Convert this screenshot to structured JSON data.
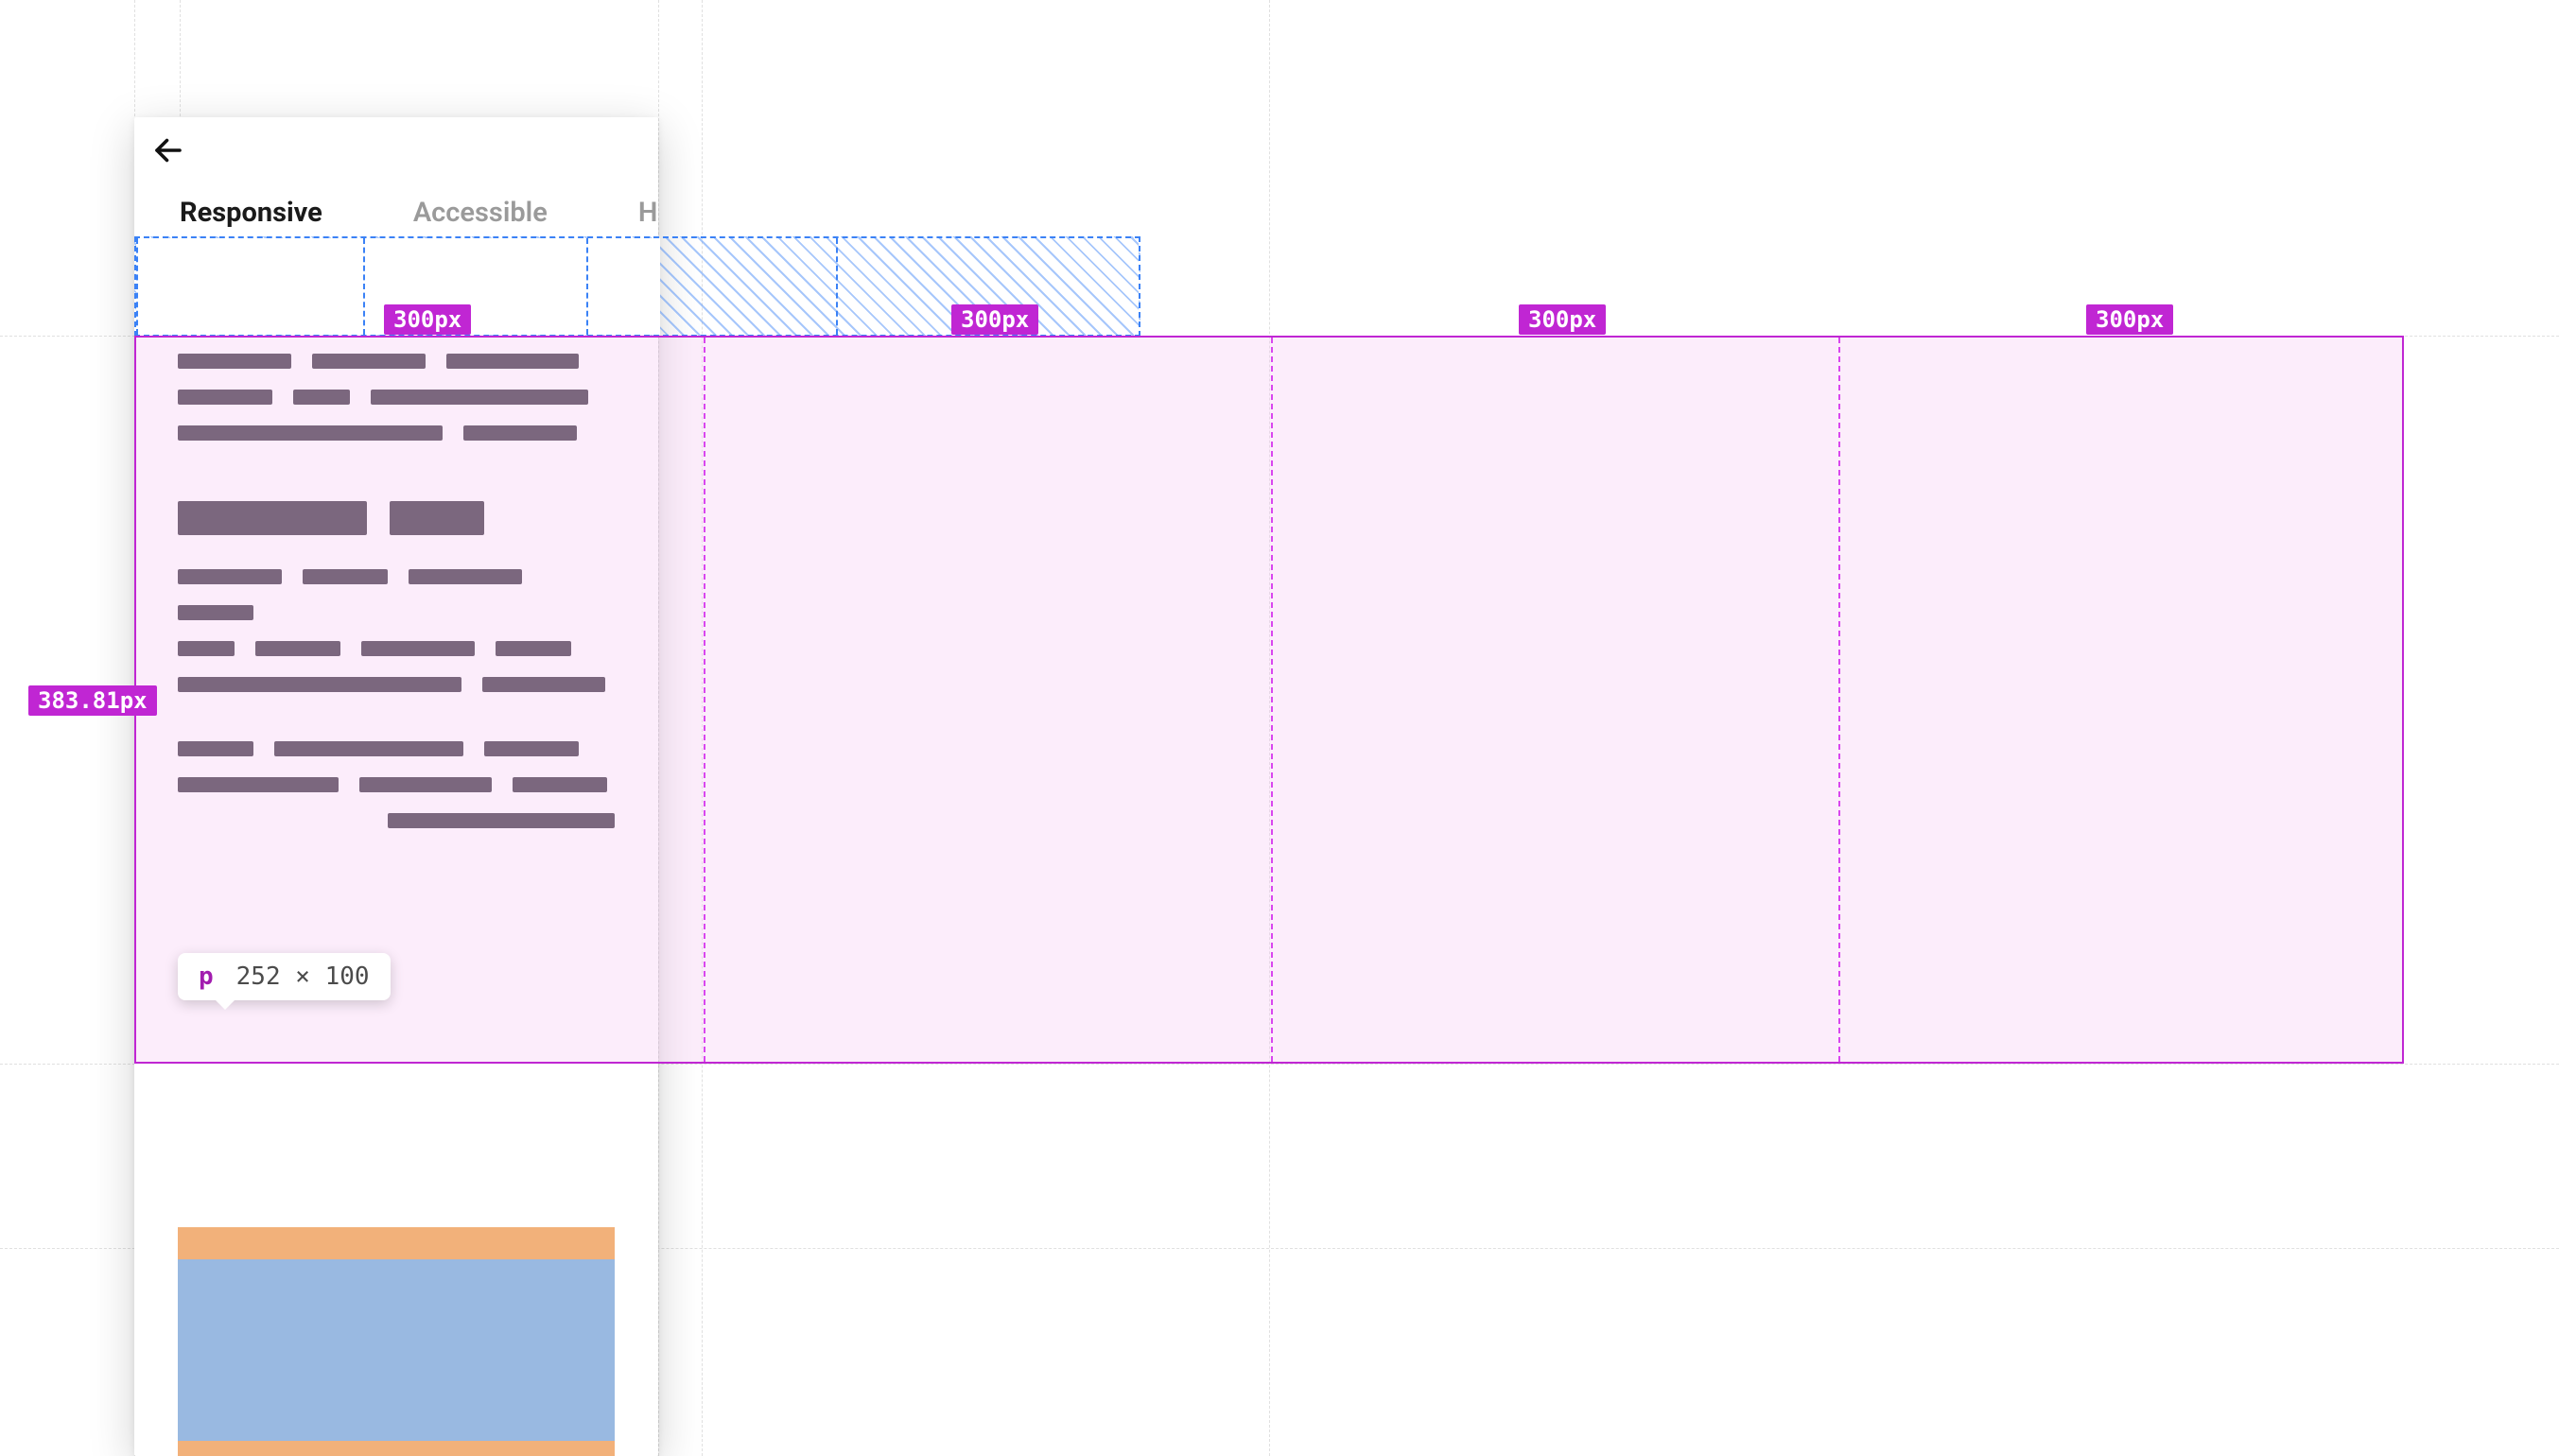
{
  "colors": {
    "magenta": "#c026d3",
    "magenta_light": "#d946ef",
    "blue_hatch": "#3b82f6",
    "pink_fill": "#f6ccf4",
    "margin_orange": "#f2b17a",
    "content_blue": "#99b9e1",
    "placeholder_dark": "#3a3240"
  },
  "tabs": {
    "items": [
      {
        "label": "Responsive",
        "active": true
      },
      {
        "label": "Accessible",
        "active": false
      },
      {
        "label": "Horizontal",
        "active": false
      }
    ]
  },
  "measurements": {
    "height_label": "383.81px",
    "col_width_labels": [
      "300px",
      "300px",
      "300px",
      "300px"
    ]
  },
  "inspected_element": {
    "tag": "p",
    "dimensions": "252 × 100"
  }
}
